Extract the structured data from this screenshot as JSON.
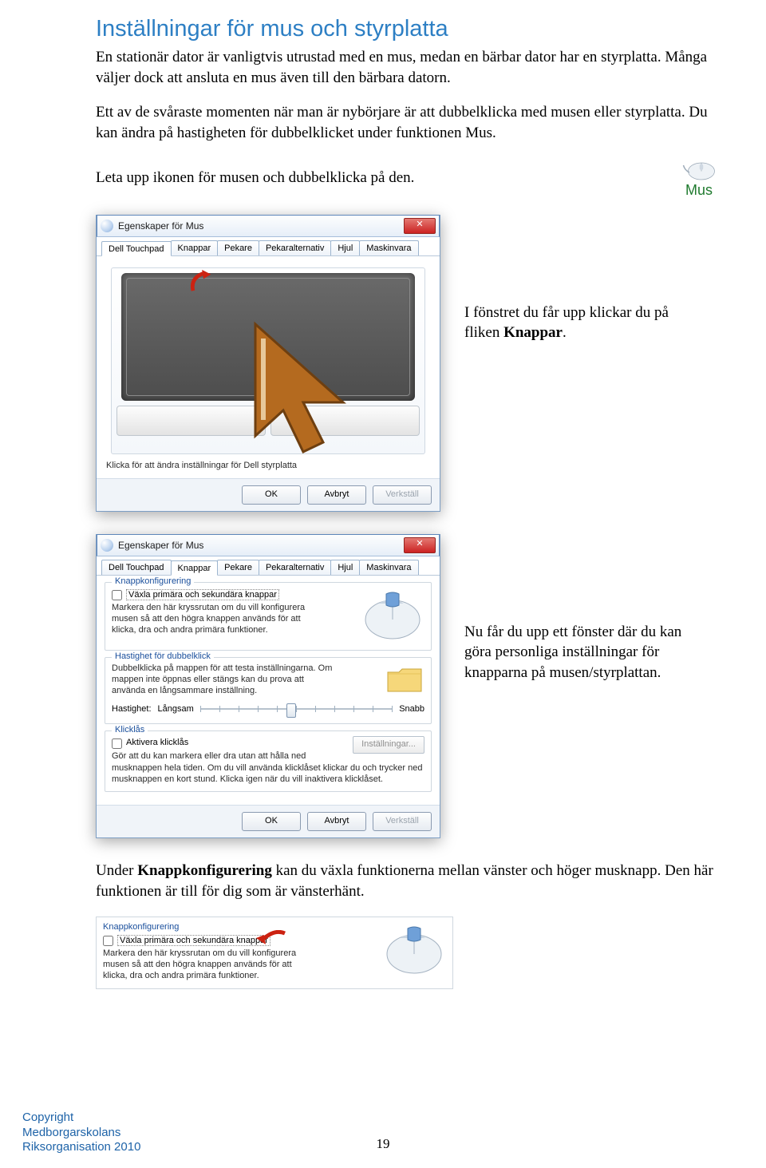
{
  "title": "Inställningar för mus och styrplatta",
  "para1": "En stationär dator är vanligtvis utrustad med en mus, medan en bärbar dator har en styrplatta. Många väljer dock att ansluta en mus även till den bärbara datorn.",
  "para2": "Ett av de svåraste momenten när man är nybörjare är att dubbelklicka med musen eller styrplatta. Du kan ändra på hastigheten för dubbelklicket under funktionen Mus.",
  "para3": "Leta upp ikonen för musen och dubbelklicka på den.",
  "mus_label": "Mus",
  "caption1_a": "I fönstret du får upp klickar du på fliken ",
  "caption1_b": "Knappar",
  "caption1_c": ".",
  "caption2": "Nu får du upp ett fönster där du kan göra personliga inställningar för knapparna på musen/styrplattan.",
  "para4_a": "Under ",
  "para4_b": "Knappkonfigurering",
  "para4_c": " kan du växla funktionerna mellan vänster och höger musknapp. Den här funktionen är till för dig som är vänsterhänt.",
  "dialog": {
    "title": "Egenskaper för Mus",
    "tabs": [
      "Dell Touchpad",
      "Knappar",
      "Pekare",
      "Pekaralternativ",
      "Hjul",
      "Maskinvara"
    ],
    "hint": "Klicka för att ändra inställningar för Dell styrplatta",
    "buttons": {
      "ok": "OK",
      "cancel": "Avbryt",
      "apply": "Verkställ"
    }
  },
  "groups": {
    "knapp": {
      "legend": "Knappkonfigurering",
      "checkbox": "Växla primära och sekundära knappar",
      "text": "Markera den här kryssrutan om du vill konfigurera musen så att den högra knappen används för att klicka, dra och andra primära funktioner."
    },
    "hastighet": {
      "legend": "Hastighet för dubbelklick",
      "text": "Dubbelklicka på mappen för att testa inställningarna. Om mappen inte öppnas eller stängs kan du prova att använda en långsammare inställning.",
      "label": "Hastighet:",
      "slow": "Långsam",
      "fast": "Snabb"
    },
    "klicklas": {
      "legend": "Klicklås",
      "checkbox": "Aktivera klicklås",
      "settings": "Inställningar...",
      "text": "Gör att du kan markera eller dra utan att hålla ned musknappen hela tiden. Om du vill använda klicklåset klickar du och trycker ned musknappen en kort stund. Klicka igen när du vill inaktivera klicklåset."
    }
  },
  "footer": {
    "l1": "Copyright",
    "l2": "Medborgarskolans",
    "l3": "Riksorganisation 2010"
  },
  "page_number": "19"
}
